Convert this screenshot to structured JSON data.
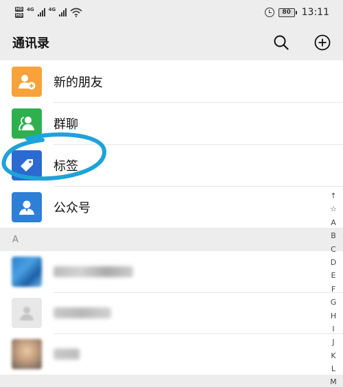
{
  "statusbar": {
    "network_a": "4G",
    "network_b": "4G",
    "battery": "80",
    "time": "13:11"
  },
  "appbar": {
    "title": "通讯录",
    "search_icon": "search-icon",
    "add_icon": "add-circle-icon"
  },
  "special_rows": [
    {
      "label": "新的朋友",
      "icon": "add-friend-icon",
      "color": "#f7a23b"
    },
    {
      "label": "群聊",
      "icon": "group-chat-icon",
      "color": "#2fb04f"
    },
    {
      "label": "标签",
      "icon": "tag-icon",
      "color": "#2b6bd1"
    },
    {
      "label": "公众号",
      "icon": "official-account-icon",
      "color": "#2e7fd6"
    }
  ],
  "sections": [
    {
      "header": "A"
    }
  ],
  "alphabet_index": [
    "↑",
    "☆",
    "A",
    "B",
    "C",
    "D",
    "E",
    "F",
    "G",
    "H",
    "I",
    "J",
    "K",
    "L",
    "M"
  ],
  "colors": {
    "highlight_scribble": "#1ea3d8",
    "background": "#ededed"
  }
}
